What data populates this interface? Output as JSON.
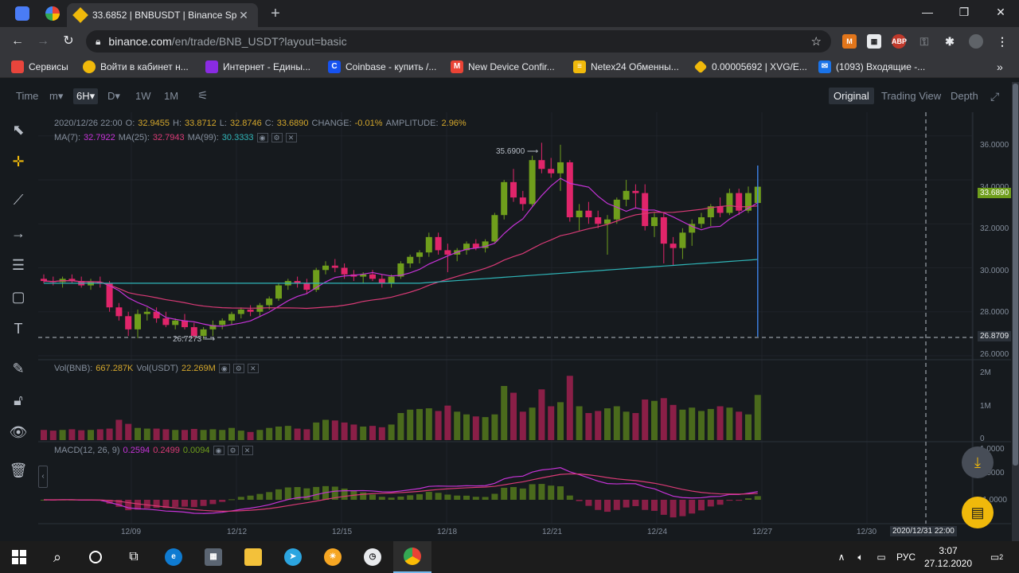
{
  "browser": {
    "active_tab_title": "33.6852 | BNBUSDT | Binance Spot",
    "url_host": "binance.com",
    "url_path": "/en/trade/BNB_USDT?layout=basic",
    "new_tab": "+",
    "minimize": "—",
    "maximize": "❐",
    "close": "✕"
  },
  "bookmarks": [
    {
      "label": "Сервисы",
      "icon": "apps-grid-icon",
      "color": "#e8453c"
    },
    {
      "label": "Войти в кабинет н...",
      "icon": "coin-icon",
      "color": "#f0b90b"
    },
    {
      "label": "Интернет - Едины...",
      "icon": "rostelecom-icon",
      "color": "#8a2be2"
    },
    {
      "label": "Coinbase - купить /...",
      "icon": "coinbase-icon",
      "color": "#1652f0"
    },
    {
      "label": "New Device Confir...",
      "icon": "gmail-icon",
      "color": "#ea4335"
    },
    {
      "label": "Netex24 Обменны...",
      "icon": "netex-icon",
      "color": "#f0b90b"
    },
    {
      "label": "0.00005692 | XVG/E...",
      "icon": "binance-icon",
      "color": "#f0b90b"
    },
    {
      "label": "(1093) Входящие -...",
      "icon": "mail-icon",
      "color": "#1a73e8"
    }
  ],
  "bookmarks_more": "»",
  "toolbar": {
    "time_label": "Time",
    "timeframes": [
      "m▾",
      "6H▾",
      "D▾",
      "1W",
      "1M"
    ],
    "active_timeframe": "6H▾",
    "views": [
      "Original",
      "Trading View",
      "Depth"
    ],
    "active_view": "Original"
  },
  "legend": {
    "ohlc": {
      "date": "2020/12/26 22:00",
      "o_label": "O:",
      "o": "32.9455",
      "h_label": "H:",
      "h": "33.8712",
      "l_label": "L:",
      "l": "32.8746",
      "c_label": "C:",
      "c": "33.6890",
      "change_label": "CHANGE:",
      "change": "-0.01%",
      "amp_label": "AMPLITUDE:",
      "amp": "2.96%"
    },
    "ma": [
      {
        "label": "MA(7):",
        "value": "32.7922",
        "color": "#c633d8"
      },
      {
        "label": "MA(25):",
        "value": "32.7943",
        "color": "#d93a76"
      },
      {
        "label": "MA(99):",
        "value": "30.3333",
        "color": "#2fb5b8"
      }
    ],
    "vol": {
      "label1": "Vol(BNB):",
      "value1": "667.287K",
      "label2": "Vol(USDT)",
      "value2": "22.269M"
    },
    "macd": {
      "label": "MACD(12, 26, 9)",
      "v1": "0.2594",
      "v2": "0.2499",
      "v3": "0.0094"
    }
  },
  "annotations": {
    "high": "35.6900",
    "low": "26.7273",
    "current_price": "33.6890",
    "crosshair_price": "26.8709",
    "crosshair_time": "2020/12/31 22:00"
  },
  "price_axis": [
    "36.0000",
    "34.0000",
    "32.0000",
    "30.0000",
    "28.0000",
    "26.0000"
  ],
  "volume_axis": [
    "2M",
    "1M",
    "0"
  ],
  "macd_axis": [
    "1.0000",
    "0.0000",
    "-1.0000"
  ],
  "date_axis": [
    "12/09",
    "12/12",
    "12/15",
    "12/18",
    "12/21",
    "12/24",
    "12/27",
    "12/30"
  ],
  "colors": {
    "up": "#6f9e1c",
    "down": "#e0256a",
    "bg": "#161a1e",
    "grid": "#1f2329"
  },
  "taskbar": {
    "lang": "РУС",
    "time": "3:07",
    "date": "27.12.2020",
    "notifications": "2"
  },
  "chart_data": {
    "type": "candlestick",
    "pair": "BNBUSDT",
    "interval": "6H",
    "x": [
      "12/07 22:00",
      "12/08 04:00",
      "12/08 10:00",
      "12/08 16:00",
      "12/08 22:00",
      "12/09 04:00",
      "12/09 10:00",
      "12/09 16:00",
      "12/09 22:00",
      "12/10 04:00",
      "12/10 10:00",
      "12/10 16:00",
      "12/10 22:00",
      "12/11 04:00",
      "12/11 10:00",
      "12/11 16:00",
      "12/11 22:00",
      "12/12 04:00",
      "12/12 10:00",
      "12/12 16:00",
      "12/12 22:00",
      "12/13 04:00",
      "12/13 10:00",
      "12/13 16:00",
      "12/13 22:00",
      "12/14 04:00",
      "12/14 10:00",
      "12/14 16:00",
      "12/14 22:00",
      "12/15 04:00",
      "12/15 10:00",
      "12/15 16:00",
      "12/15 22:00",
      "12/16 04:00",
      "12/16 10:00",
      "12/16 16:00",
      "12/16 22:00",
      "12/17 04:00",
      "12/17 10:00",
      "12/17 16:00",
      "12/17 22:00",
      "12/18 04:00",
      "12/18 10:00",
      "12/18 16:00",
      "12/18 22:00",
      "12/19 04:00",
      "12/19 10:00",
      "12/19 16:00",
      "12/19 22:00",
      "12/20 04:00",
      "12/20 10:00",
      "12/20 16:00",
      "12/20 22:00",
      "12/21 04:00",
      "12/21 10:00",
      "12/21 16:00",
      "12/21 22:00",
      "12/22 04:00",
      "12/22 10:00",
      "12/22 16:00",
      "12/22 22:00",
      "12/23 04:00",
      "12/23 10:00",
      "12/23 16:00",
      "12/23 22:00",
      "12/24 04:00",
      "12/24 10:00",
      "12/24 16:00",
      "12/24 22:00",
      "12/25 04:00",
      "12/25 10:00",
      "12/25 16:00",
      "12/25 22:00",
      "12/26 04:00",
      "12/26 10:00",
      "12/26 16:00",
      "12/26 22:00"
    ],
    "ohlc": [
      [
        29.5,
        29.7,
        29.3,
        29.4
      ],
      [
        29.4,
        29.6,
        29.2,
        29.35
      ],
      [
        29.35,
        29.6,
        29.1,
        29.5
      ],
      [
        29.5,
        29.7,
        29.3,
        29.4
      ],
      [
        29.4,
        29.6,
        29.1,
        29.2
      ],
      [
        29.2,
        29.5,
        29.0,
        29.35
      ],
      [
        29.35,
        29.6,
        29.1,
        29.3
      ],
      [
        29.3,
        29.4,
        28.0,
        28.2
      ],
      [
        28.2,
        28.4,
        27.6,
        27.8
      ],
      [
        27.8,
        28.0,
        26.9,
        27.2
      ],
      [
        27.2,
        28.1,
        26.8,
        27.9
      ],
      [
        27.9,
        28.2,
        27.6,
        28.0
      ],
      [
        28.0,
        28.2,
        27.5,
        27.7
      ],
      [
        27.7,
        28.0,
        27.3,
        27.4
      ],
      [
        27.4,
        27.7,
        27.2,
        27.6
      ],
      [
        27.6,
        27.9,
        27.2,
        27.3
      ],
      [
        27.3,
        27.5,
        26.8,
        26.9
      ],
      [
        26.9,
        27.3,
        26.73,
        27.2
      ],
      [
        27.2,
        27.6,
        26.9,
        27.4
      ],
      [
        27.4,
        27.7,
        27.2,
        27.6
      ],
      [
        27.6,
        28.0,
        27.4,
        27.9
      ],
      [
        27.9,
        28.2,
        27.7,
        28.1
      ],
      [
        28.1,
        28.3,
        27.8,
        28.0
      ],
      [
        28.0,
        28.4,
        27.8,
        28.3
      ],
      [
        28.3,
        28.7,
        28.1,
        28.6
      ],
      [
        28.6,
        29.3,
        28.5,
        29.2
      ],
      [
        29.2,
        29.5,
        29.0,
        29.4
      ],
      [
        29.4,
        29.6,
        29.1,
        29.3
      ],
      [
        29.3,
        29.5,
        28.8,
        29.0
      ],
      [
        29.0,
        30.0,
        28.9,
        29.9
      ],
      [
        29.9,
        30.3,
        29.7,
        30.1
      ],
      [
        30.1,
        30.4,
        29.8,
        30.0
      ],
      [
        30.0,
        30.2,
        29.5,
        29.7
      ],
      [
        29.7,
        29.9,
        29.4,
        29.6
      ],
      [
        29.6,
        29.8,
        29.3,
        29.7
      ],
      [
        29.7,
        29.9,
        29.4,
        29.5
      ],
      [
        29.5,
        29.7,
        29.1,
        29.3
      ],
      [
        29.3,
        29.7,
        29.1,
        29.6
      ],
      [
        29.6,
        30.3,
        29.5,
        30.2
      ],
      [
        30.2,
        30.6,
        30.0,
        30.5
      ],
      [
        30.5,
        30.8,
        30.2,
        30.7
      ],
      [
        30.7,
        31.6,
        30.5,
        31.4
      ],
      [
        31.4,
        31.6,
        30.6,
        30.8
      ],
      [
        30.8,
        31.1,
        29.8,
        30.6
      ],
      [
        30.6,
        30.9,
        30.3,
        30.8
      ],
      [
        30.8,
        31.2,
        30.6,
        31.1
      ],
      [
        31.1,
        31.3,
        30.8,
        30.9
      ],
      [
        30.9,
        31.3,
        30.7,
        31.2
      ],
      [
        31.2,
        32.5,
        31.1,
        32.4
      ],
      [
        32.4,
        34.0,
        32.2,
        33.9
      ],
      [
        33.9,
        34.5,
        33.0,
        33.2
      ],
      [
        33.2,
        33.5,
        32.6,
        32.9
      ],
      [
        32.9,
        35.1,
        32.8,
        34.9
      ],
      [
        34.9,
        35.69,
        34.3,
        34.5
      ],
      [
        34.5,
        35.0,
        34.1,
        34.3
      ],
      [
        34.3,
        35.6,
        33.5,
        34.8
      ],
      [
        34.8,
        34.9,
        32.1,
        32.3
      ],
      [
        32.3,
        32.9,
        31.7,
        32.6
      ],
      [
        32.6,
        33.0,
        32.0,
        32.3
      ],
      [
        32.3,
        32.6,
        31.8,
        32.0
      ],
      [
        32.0,
        32.4,
        30.6,
        32.2
      ],
      [
        32.2,
        33.2,
        32.0,
        33.1
      ],
      [
        33.1,
        34.0,
        32.8,
        33.5
      ],
      [
        33.5,
        33.8,
        32.7,
        33.4
      ],
      [
        33.4,
        33.8,
        31.7,
        31.9
      ],
      [
        31.9,
        32.5,
        31.4,
        32.3
      ],
      [
        32.3,
        32.5,
        30.2,
        31.1
      ],
      [
        31.1,
        31.4,
        30.1,
        30.9
      ],
      [
        30.9,
        31.8,
        30.4,
        31.6
      ],
      [
        31.6,
        32.2,
        31.0,
        32.0
      ],
      [
        32.0,
        32.5,
        31.8,
        32.3
      ],
      [
        32.3,
        32.9,
        31.9,
        32.8
      ],
      [
        32.8,
        33.2,
        32.3,
        32.5
      ],
      [
        32.5,
        33.6,
        32.4,
        33.4
      ],
      [
        33.4,
        33.6,
        32.4,
        32.6
      ],
      [
        32.6,
        33.7,
        32.5,
        33.4
      ],
      [
        32.95,
        33.87,
        32.87,
        33.69
      ]
    ],
    "volume_bnb_k": [
      150,
      140,
      150,
      160,
      145,
      150,
      160,
      170,
      300,
      240,
      180,
      170,
      170,
      160,
      150,
      150,
      165,
      150,
      160,
      150,
      180,
      140,
      120,
      150,
      180,
      200,
      210,
      170,
      160,
      260,
      300,
      290,
      260,
      230,
      200,
      210,
      190,
      230,
      400,
      450,
      460,
      470,
      430,
      510,
      420,
      380,
      350,
      340,
      380,
      800,
      700,
      420,
      480,
      750,
      500,
      560,
      950,
      500,
      400,
      430,
      470,
      500,
      420,
      400,
      600,
      580,
      620,
      520,
      450,
      480,
      430,
      460,
      500,
      480,
      420,
      380,
      667.287
    ],
    "macd_series": {
      "name": "MACD(12, 26, 9)",
      "dif_last": 0.2594,
      "dea_last": 0.2499,
      "hist_last": 0.0094
    },
    "ylim": [
      26,
      36.5
    ]
  }
}
